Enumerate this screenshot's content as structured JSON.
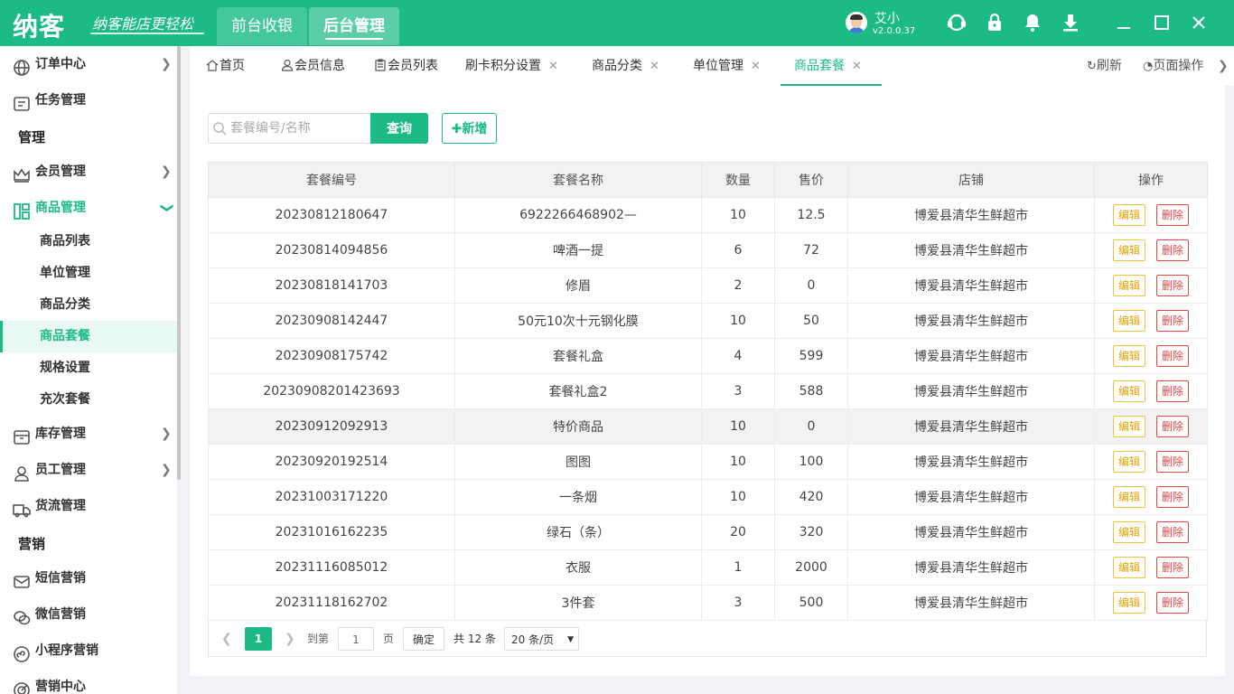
{
  "header": {
    "logo": "纳客",
    "slogan": "纳客能店更轻松",
    "nav": [
      {
        "label": "前台收银"
      },
      {
        "label": "后台管理"
      }
    ],
    "user_name": "艾小",
    "version": "v2.0.0.37"
  },
  "sidebar": {
    "items": [
      {
        "label": "订单中心",
        "icon": "globe-icon"
      },
      {
        "label": "任务管理",
        "icon": "task-icon"
      }
    ],
    "section_manage": "管理",
    "member": {
      "label": "会员管理",
      "icon": "crown-icon"
    },
    "goods": {
      "label": "商品管理",
      "icon": "goods-icon"
    },
    "goods_sub": [
      {
        "label": "商品列表"
      },
      {
        "label": "单位管理"
      },
      {
        "label": "商品分类"
      },
      {
        "label": "商品套餐"
      },
      {
        "label": "规格设置"
      },
      {
        "label": "充次套餐"
      }
    ],
    "stock": {
      "label": "库存管理",
      "icon": "box-icon"
    },
    "staff": {
      "label": "员工管理",
      "icon": "user-icon"
    },
    "logistics": {
      "label": "货流管理",
      "icon": "truck-icon"
    },
    "section_marketing": "营销",
    "sms": {
      "label": "短信营销",
      "icon": "mail-icon"
    },
    "wechat": {
      "label": "微信营销",
      "icon": "wechat-icon"
    },
    "miniapp": {
      "label": "小程序营销",
      "icon": "miniapp-icon"
    },
    "center": {
      "label": "营销中心",
      "icon": "target-icon"
    }
  },
  "tabs": [
    {
      "label": "首页"
    },
    {
      "label": "会员信息"
    },
    {
      "label": "会员列表"
    },
    {
      "label": "刷卡积分设置"
    },
    {
      "label": "商品分类"
    },
    {
      "label": "单位管理"
    },
    {
      "label": "商品套餐"
    }
  ],
  "tab_close": "✕",
  "tab_actions": {
    "refresh": "刷新",
    "page_ops": "页面操作"
  },
  "search": {
    "placeholder": "套餐编号/名称",
    "value": ""
  },
  "buttons": {
    "query": "查询",
    "add": "新增"
  },
  "table": {
    "columns": [
      "套餐编号",
      "套餐名称",
      "数量",
      "售价",
      "店铺",
      "操作"
    ],
    "edit_label": "编辑",
    "delete_label": "删除",
    "rows": [
      {
        "code": "20230812180647",
        "name": "6922266468902—",
        "qty": "10",
        "price": "12.5",
        "shop": "博爱县清华生鲜超市"
      },
      {
        "code": "20230814094856",
        "name": "啤酒一提",
        "qty": "6",
        "price": "72",
        "shop": "博爱县清华生鲜超市"
      },
      {
        "code": "20230818141703",
        "name": "修眉",
        "qty": "2",
        "price": "0",
        "shop": "博爱县清华生鲜超市"
      },
      {
        "code": "20230908142447",
        "name": "50元10次十元钢化膜",
        "qty": "10",
        "price": "50",
        "shop": "博爱县清华生鲜超市"
      },
      {
        "code": "20230908175742",
        "name": "套餐礼盒",
        "qty": "4",
        "price": "599",
        "shop": "博爱县清华生鲜超市"
      },
      {
        "code": "20230908201423693",
        "name": "套餐礼盒2",
        "qty": "3",
        "price": "588",
        "shop": "博爱县清华生鲜超市"
      },
      {
        "code": "20230912092913",
        "name": "特价商品",
        "qty": "10",
        "price": "0",
        "shop": "博爱县清华生鲜超市"
      },
      {
        "code": "20230920192514",
        "name": "图图",
        "qty": "10",
        "price": "100",
        "shop": "博爱县清华生鲜超市"
      },
      {
        "code": "20231003171220",
        "name": "一条烟",
        "qty": "10",
        "price": "420",
        "shop": "博爱县清华生鲜超市"
      },
      {
        "code": "20231016162235",
        "name": "绿石（条）",
        "qty": "20",
        "price": "320",
        "shop": "博爱县清华生鲜超市"
      },
      {
        "code": "20231116085012",
        "name": "衣服",
        "qty": "1",
        "price": "2000",
        "shop": "博爱县清华生鲜超市"
      },
      {
        "code": "20231118162702",
        "name": "3件套",
        "qty": "3",
        "price": "500",
        "shop": "博爱县清华生鲜超市"
      }
    ]
  },
  "pagination": {
    "current": "1",
    "goto_label": "到第",
    "goto_value": "1",
    "page_label": "页",
    "confirm": "确定",
    "total": "共 12 条",
    "page_size": "20 条/页"
  },
  "colors": {
    "brand": "#1cbb83",
    "edit": "#e6a100",
    "delete": "#e54545"
  }
}
